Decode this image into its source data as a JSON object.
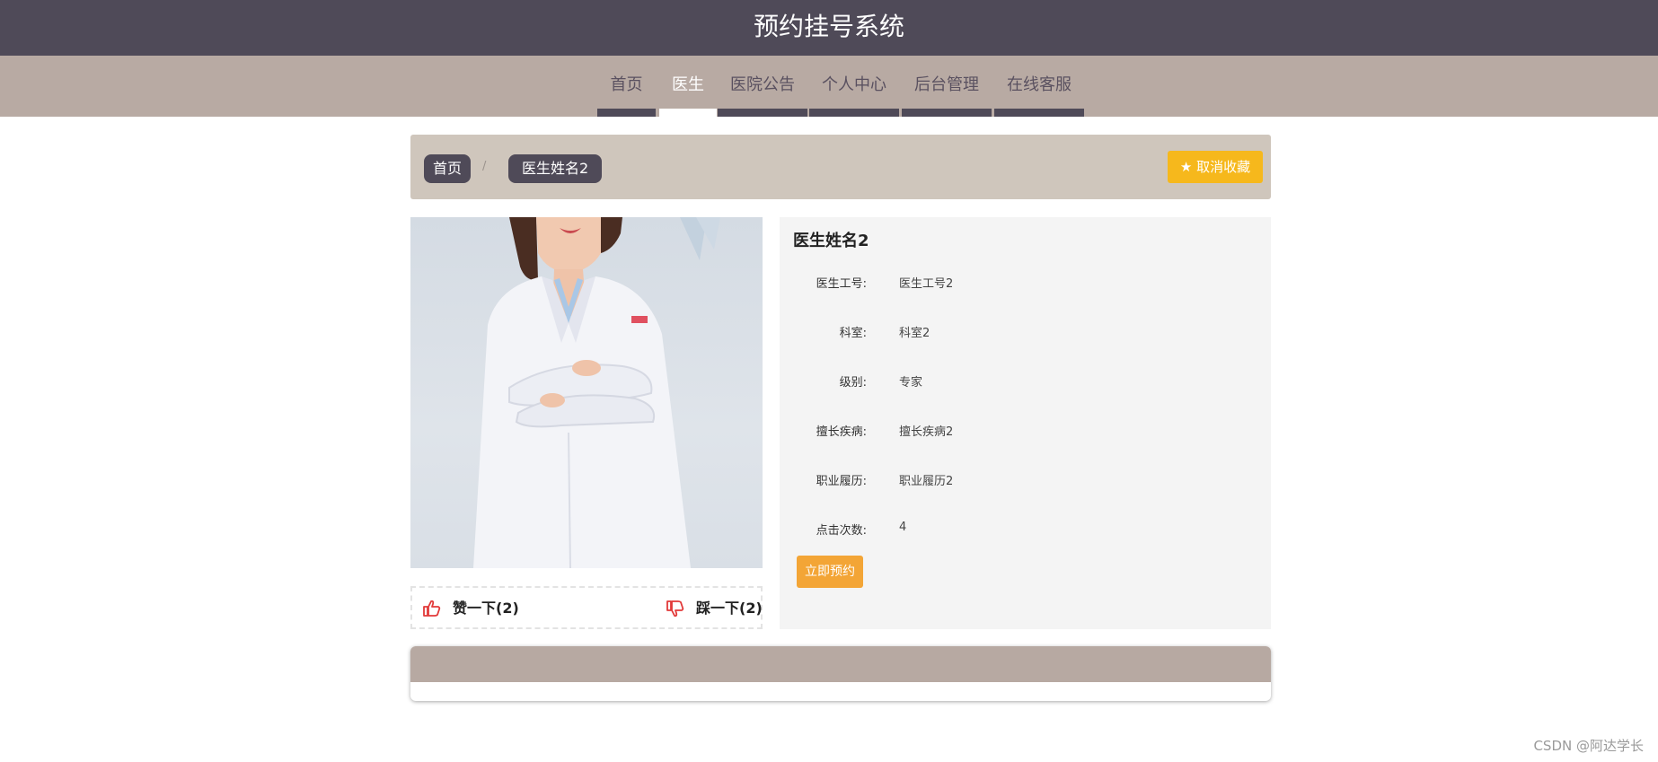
{
  "header": {
    "title": "预约挂号系统"
  },
  "nav": {
    "items": [
      {
        "label": "首页",
        "active": false
      },
      {
        "label": "医生",
        "active": true
      },
      {
        "label": "医院公告",
        "active": false
      },
      {
        "label": "个人中心",
        "active": false
      },
      {
        "label": "后台管理",
        "active": false
      },
      {
        "label": "在线客服",
        "active": false
      }
    ]
  },
  "breadcrumb": {
    "items": [
      "首页",
      "医生姓名2"
    ],
    "separator": "/"
  },
  "favorite": {
    "label": "取消收藏",
    "icon": "star-icon"
  },
  "doctor": {
    "name": "医生姓名2",
    "fields": [
      {
        "label": "医生工号:",
        "value": "医生工号2"
      },
      {
        "label": "科室:",
        "value": "科室2"
      },
      {
        "label": "级别:",
        "value": "专家"
      },
      {
        "label": "擅长疾病:",
        "value": "擅长疾病2"
      },
      {
        "label": "职业履历:",
        "value": "职业履历2"
      },
      {
        "label": "点击次数:",
        "value": "4"
      }
    ],
    "book_label": "立即预约"
  },
  "votes": {
    "like_label": "赞一下(2)",
    "dislike_label": "踩一下(2)",
    "like_icon": "thumbs-up-icon",
    "dislike_icon": "thumbs-down-icon"
  },
  "watermark": "CSDN @阿达学长",
  "colors": {
    "header_bg": "#4f4a58",
    "nav_bg": "#b8aaa3",
    "breadcrumb_bg": "#cfc6bc",
    "favorite_btn": "#f6b81c",
    "book_btn": "#f3a536",
    "vote_icon": "#e23a3a"
  }
}
